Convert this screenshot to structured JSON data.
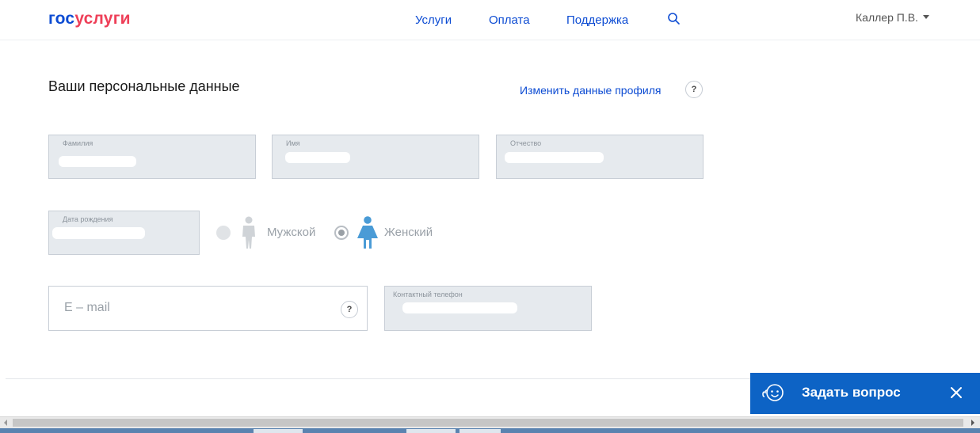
{
  "header": {
    "logo_part1": "гос",
    "logo_part2": "услуги",
    "nav": {
      "services": "Услуги",
      "payment": "Оплата",
      "support": "Поддержка"
    },
    "user_name": "Каллер П.В."
  },
  "profile": {
    "title": "Ваши персональные данные",
    "edit_link": "Изменить данные профиля",
    "help_symbol": "?",
    "fields": {
      "surname_label": "Фамилия",
      "name_label": "Имя",
      "patronymic_label": "Отчество",
      "birthdate_label": "Дата рождения",
      "phone_label": "Контактный телефон",
      "email_placeholder": "E – mail"
    },
    "gender": {
      "male": "Мужской",
      "female": "Женский",
      "selected": "Женский"
    }
  },
  "chat": {
    "label": "Задать вопрос"
  },
  "colors": {
    "brand_blue": "#0d4cd3",
    "brand_red": "#ee3f58",
    "chat_blue": "#0d63c5",
    "female_icon": "#4a9bd6"
  }
}
